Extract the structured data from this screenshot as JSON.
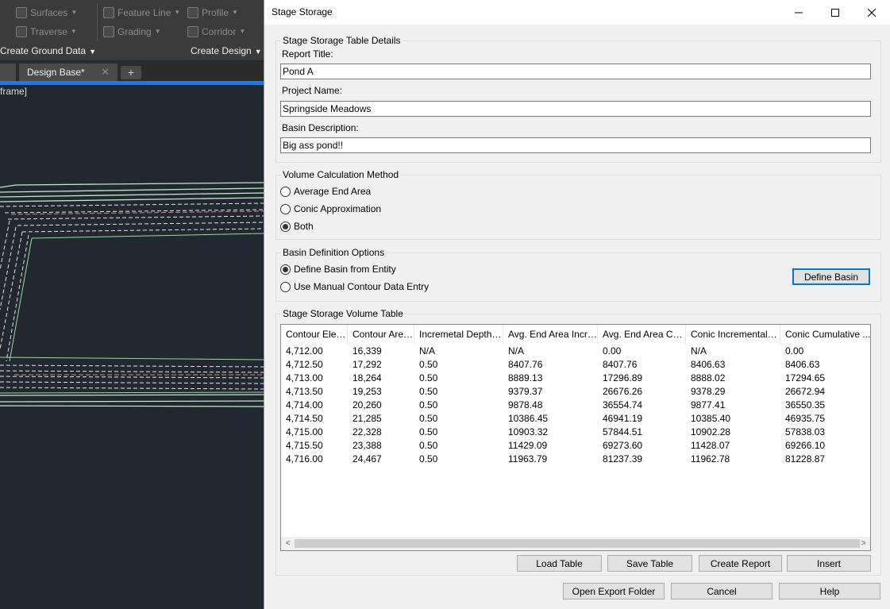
{
  "cad": {
    "ribbon": {
      "buttons": [
        {
          "label": "Surfaces",
          "icon": "surfaces-icon"
        },
        {
          "label": "Traverse",
          "icon": "traverse-icon"
        },
        {
          "label": "Feature Line",
          "icon": "feature-line-icon"
        },
        {
          "label": "Grading",
          "icon": "grading-icon"
        },
        {
          "label": "Profile",
          "icon": "profile-icon"
        },
        {
          "label": "Corridor",
          "icon": "corridor-icon"
        }
      ],
      "panel_titles": [
        "Create Ground Data",
        "Create Design"
      ]
    },
    "doc_tab": "Design Base*",
    "viewport_label": "frame]"
  },
  "dialog": {
    "title": "Stage Storage",
    "details": {
      "legend": "Stage Storage Table Details",
      "report_title_label": "Report Title:",
      "report_title_value": "Pond A",
      "project_name_label": "Project Name:",
      "project_name_value": "Springside Meadows",
      "basin_description_label": "Basin Description:",
      "basin_description_value": "Big ass pond!!"
    },
    "method": {
      "legend": "Volume Calculation Method",
      "options": [
        "Average End Area",
        "Conic Approximation",
        "Both"
      ],
      "selected": "Both"
    },
    "basin": {
      "legend": "Basin Definition Options",
      "options": [
        "Define Basin from Entity",
        "Use Manual Contour Data Entry"
      ],
      "selected": "Define Basin from Entity",
      "define_button": "Define Basin"
    },
    "table": {
      "legend": "Stage Storage Volume Table",
      "columns": [
        "Contour Elev...",
        "Contour Area...",
        "Incremetal Depth (ft)",
        "Avg. End Area Incre...",
        "Avg. End Area Cu...",
        "Conic Incremental V...",
        "Conic Cumulative ..."
      ],
      "rows": [
        [
          "4,712.00",
          "16,339",
          "N/A",
          "N/A",
          "0.00",
          "N/A",
          "0.00"
        ],
        [
          "4,712.50",
          "17,292",
          "0.50",
          "8407.76",
          "8407.76",
          "8406.63",
          "8406.63"
        ],
        [
          "4,713.00",
          "18,264",
          "0.50",
          "8889.13",
          "17296.89",
          "8888.02",
          "17294.65"
        ],
        [
          "4,713.50",
          "19,253",
          "0.50",
          "9379.37",
          "26676.26",
          "9378.29",
          "26672.94"
        ],
        [
          "4,714.00",
          "20,260",
          "0.50",
          "9878.48",
          "36554.74",
          "9877.41",
          "36550.35"
        ],
        [
          "4,714.50",
          "21,285",
          "0.50",
          "10386.45",
          "46941.19",
          "10385.40",
          "46935.75"
        ],
        [
          "4,715.00",
          "22,328",
          "0.50",
          "10903.32",
          "57844.51",
          "10902.28",
          "57838.03"
        ],
        [
          "4,715.50",
          "23,388",
          "0.50",
          "11429.09",
          "69273.60",
          "11428.07",
          "69266.10"
        ],
        [
          "4,716.00",
          "24,467",
          "0.50",
          "11963.79",
          "81237.39",
          "11962.78",
          "81228.87"
        ]
      ]
    },
    "table_buttons": {
      "load": "Load Table",
      "save": "Save Table",
      "report": "Create Report",
      "insert": "Insert"
    },
    "bottom_buttons": {
      "export": "Open Export Folder",
      "cancel": "Cancel",
      "help": "Help"
    }
  }
}
